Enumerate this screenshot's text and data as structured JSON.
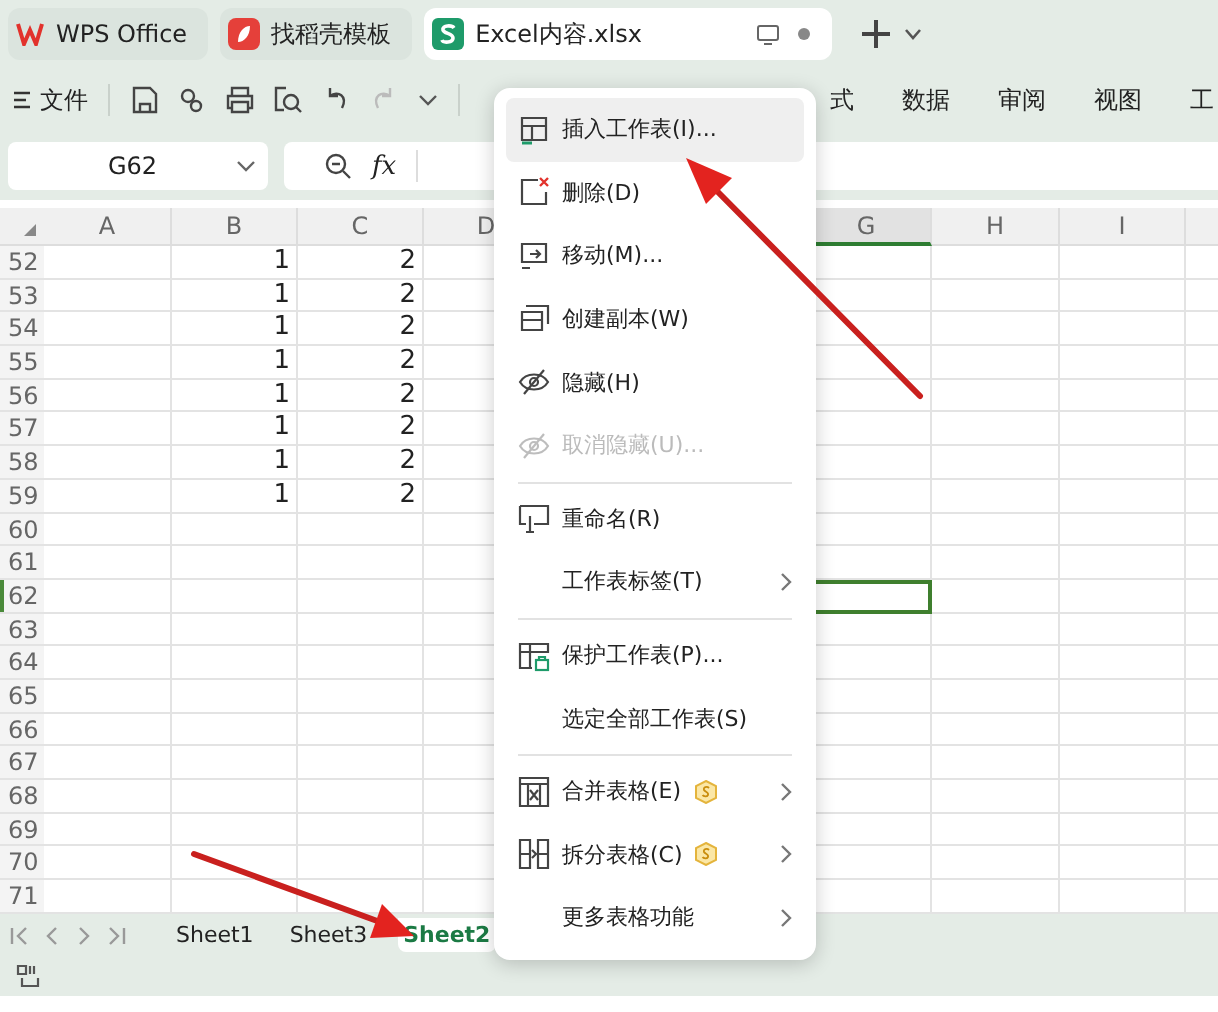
{
  "app_tabs": [
    {
      "label": "WPS Office",
      "kind": "home",
      "selected": false
    },
    {
      "label": "找稻壳模板",
      "kind": "template",
      "selected": false
    },
    {
      "label": "Excel内容.xlsx",
      "kind": "sheet",
      "selected": true
    }
  ],
  "toolbar": {
    "menu_label": "文件",
    "ribbon_tabs": [
      "式",
      "数据",
      "审阅",
      "视图",
      "工"
    ]
  },
  "formula_bar": {
    "name_box": "G62",
    "fx_label": "fx"
  },
  "columns": [
    {
      "label": "A",
      "selected": false
    },
    {
      "label": "B",
      "selected": false
    },
    {
      "label": "C",
      "selected": false
    },
    {
      "label": "D",
      "selected": false
    },
    {
      "label": "G",
      "selected": true
    },
    {
      "label": "H",
      "selected": false
    },
    {
      "label": "I",
      "selected": false
    }
  ],
  "rows": [
    {
      "number": "52",
      "column_b": "1",
      "column_c": "2",
      "selected": false
    },
    {
      "number": "53",
      "column_b": "1",
      "column_c": "2",
      "selected": false
    },
    {
      "number": "54",
      "column_b": "1",
      "column_c": "2",
      "selected": false
    },
    {
      "number": "55",
      "column_b": "1",
      "column_c": "2",
      "selected": false
    },
    {
      "number": "56",
      "column_b": "1",
      "column_c": "2",
      "selected": false
    },
    {
      "number": "57",
      "column_b": "1",
      "column_c": "2",
      "selected": false
    },
    {
      "number": "58",
      "column_b": "1",
      "column_c": "2",
      "selected": false
    },
    {
      "number": "59",
      "column_b": "1",
      "column_c": "2",
      "selected": false
    },
    {
      "number": "60",
      "selected": false
    },
    {
      "number": "61",
      "selected": false
    },
    {
      "number": "62",
      "selected": true
    },
    {
      "number": "63",
      "selected": false
    },
    {
      "number": "64",
      "selected": false
    },
    {
      "number": "65",
      "selected": false
    },
    {
      "number": "66",
      "selected": false
    },
    {
      "number": "67",
      "selected": false
    },
    {
      "number": "68",
      "selected": false
    },
    {
      "number": "69",
      "selected": false
    },
    {
      "number": "70",
      "selected": false
    },
    {
      "number": "71",
      "selected": false
    }
  ],
  "context_menu": [
    {
      "kind": "item",
      "label": "插入工作表(I)...",
      "highlighted": true,
      "disabled": false,
      "submenu": false,
      "premium": false
    },
    {
      "kind": "item",
      "label": "删除(D)",
      "highlighted": false,
      "disabled": false,
      "submenu": false,
      "premium": false
    },
    {
      "kind": "item",
      "label": "移动(M)...",
      "highlighted": false,
      "disabled": false,
      "submenu": false,
      "premium": false
    },
    {
      "kind": "item",
      "label": "创建副本(W)",
      "highlighted": false,
      "disabled": false,
      "submenu": false,
      "premium": false
    },
    {
      "kind": "item",
      "label": "隐藏(H)",
      "highlighted": false,
      "disabled": false,
      "submenu": false,
      "premium": false
    },
    {
      "kind": "item",
      "label": "取消隐藏(U)...",
      "highlighted": false,
      "disabled": true,
      "submenu": false,
      "premium": false
    },
    {
      "kind": "separator"
    },
    {
      "kind": "item",
      "label": "重命名(R)",
      "highlighted": false,
      "disabled": false,
      "submenu": false,
      "premium": false
    },
    {
      "kind": "item",
      "label": "工作表标签(T)",
      "highlighted": false,
      "disabled": false,
      "submenu": true,
      "premium": false
    },
    {
      "kind": "separator"
    },
    {
      "kind": "item",
      "label": "保护工作表(P)...",
      "highlighted": false,
      "disabled": false,
      "submenu": false,
      "premium": false
    },
    {
      "kind": "item",
      "label": "选定全部工作表(S)",
      "highlighted": false,
      "disabled": false,
      "submenu": false,
      "premium": false
    },
    {
      "kind": "separator"
    },
    {
      "kind": "item",
      "label": "合并表格(E)",
      "highlighted": false,
      "disabled": false,
      "submenu": true,
      "premium": true
    },
    {
      "kind": "item",
      "label": "拆分表格(C)",
      "highlighted": false,
      "disabled": false,
      "submenu": true,
      "premium": true
    },
    {
      "kind": "item",
      "label": "更多表格功能",
      "highlighted": false,
      "disabled": false,
      "submenu": true,
      "premium": false
    }
  ],
  "sheet_tabs": [
    {
      "label": "Sheet1",
      "selected": false
    },
    {
      "label": "Sheet3",
      "selected": false
    },
    {
      "label": "Sheet2",
      "selected": true
    }
  ]
}
